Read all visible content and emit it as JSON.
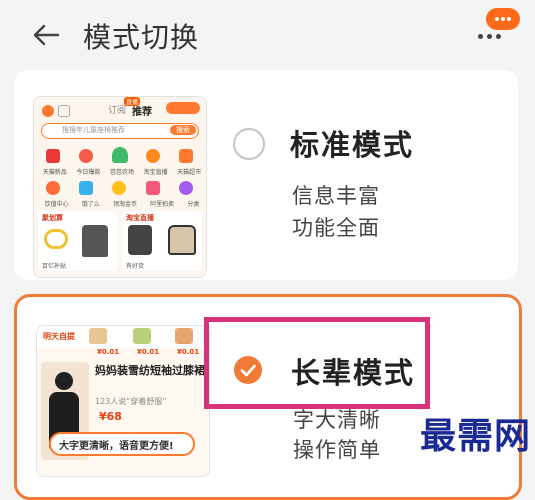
{
  "header": {
    "title": "模式切换"
  },
  "thumb_standard": {
    "tab_follow": "订阅",
    "tab_recommend": "推荐",
    "badge": "直播",
    "search_placeholder": "搜搜年儿童座椅推荐",
    "search_button": "搜索",
    "labels_row1": [
      "天猫新品",
      "今日爆款",
      "芭芭农场",
      "淘宝直播",
      "天猫超市"
    ],
    "labels_row2": [
      "饮值中心",
      "饿了么",
      "领淘金币",
      "阿里拍卖",
      "分类"
    ],
    "section_left": "聚划算",
    "section_right": "淘宝直播",
    "bottom_left": "百亿补贴",
    "bottom_right": "有好货"
  },
  "modes": [
    {
      "name": "标准模式",
      "desc1": "信息丰富",
      "desc2": "功能全面",
      "selected": false
    },
    {
      "name": "长辈模式",
      "desc1": "字大清晰",
      "desc2": "操作简单",
      "selected": true
    }
  ],
  "thumb_elder": {
    "header": "明天自提",
    "price_tag": "¥0.01",
    "product_title": "妈妈装雪纺短袖过膝裙",
    "sold_text": "123人说“穿着舒服”",
    "price": "¥68",
    "banner": "大字更清晰，语音更方便!"
  },
  "watermark": "最需网",
  "colors": {
    "accent": "#f07a36",
    "highlight": "#d6337a",
    "watermark": "#1b2a93"
  }
}
